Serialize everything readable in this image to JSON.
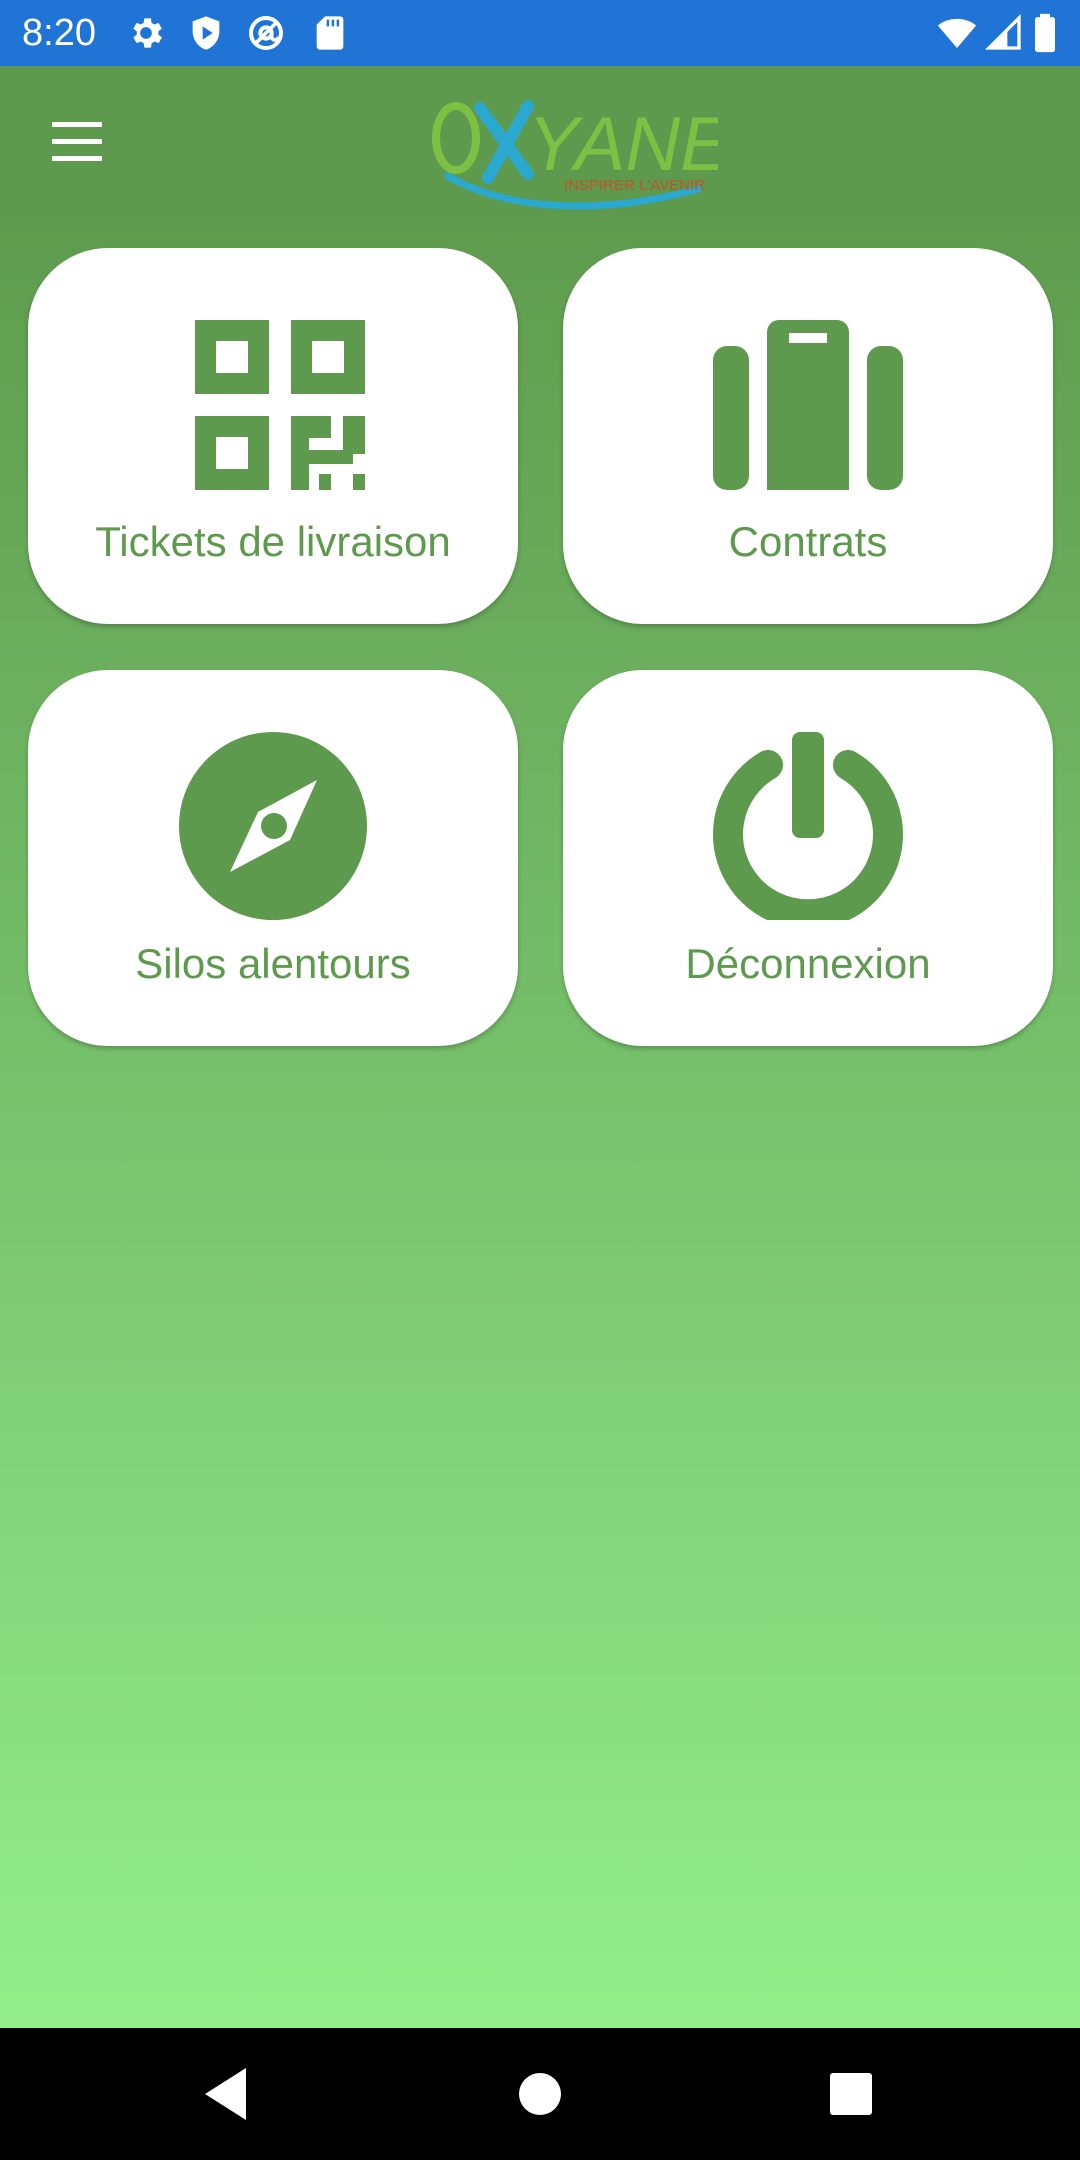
{
  "status_bar": {
    "time": "8:20",
    "background": "#1f74d6",
    "left_icons": [
      "gear-icon",
      "shield-play-icon",
      "at-sync-icon",
      "sd-card-icon"
    ],
    "right_icons": [
      "wifi-icon",
      "cell-signal-icon",
      "battery-icon"
    ]
  },
  "app_bar": {
    "menu_icon": "hamburger-menu-icon",
    "logo": {
      "name": "OXYANE",
      "tagline": "INSPIRER L'AVENIR"
    }
  },
  "tiles": [
    {
      "label": "Tickets de livraison",
      "icon": "qr-code-icon"
    },
    {
      "label": "Contrats",
      "icon": "suitcase-icon"
    },
    {
      "label": "Silos alentours",
      "icon": "compass-icon"
    },
    {
      "label": "Déconnexion",
      "icon": "power-icon"
    }
  ],
  "nav_bar": {
    "buttons": [
      "back-icon",
      "home-icon",
      "recents-icon"
    ]
  },
  "colors": {
    "primary_green": "#5e9a4d",
    "gradient_bottom": "#93ee8a",
    "tile_background": "#ffffff",
    "logo_green": "#7dc043",
    "logo_blue": "#2aa8cf",
    "logo_tagline": "#c0552a"
  }
}
